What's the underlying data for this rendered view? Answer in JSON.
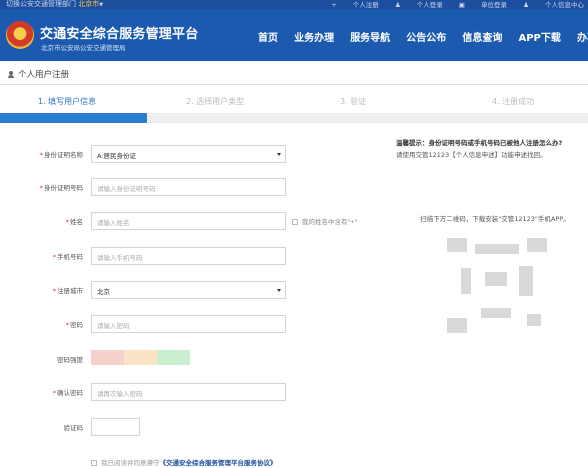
{
  "topbar": {
    "switch_prefix": "切换公安交通管理部门",
    "city": "北京市",
    "links": [
      "个人注册",
      "个人登录",
      "单位登录",
      "个人信息中心"
    ]
  },
  "header": {
    "title": "交通安全综合服务管理平台",
    "subtitle": "北京市公安局公安交通管理局",
    "nav": [
      "首页",
      "业务办理",
      "服务导航",
      "公告公布",
      "信息查询",
      "APP下载",
      "办事指南"
    ]
  },
  "breadcrumb": "个人用户注册",
  "steps": [
    {
      "label": "1. 填写用户信息",
      "active": true
    },
    {
      "label": "2. 选择用户类型",
      "active": false
    },
    {
      "label": "3. 验证",
      "active": false
    },
    {
      "label": "4. 注册成功",
      "active": false
    }
  ],
  "progress": 0.25,
  "form": {
    "id_type": {
      "label": "身份证明名称",
      "value": "A:居民身份证",
      "required": true
    },
    "id_number": {
      "label": "身份证明号码",
      "placeholder": "请输入身份证明号码",
      "required": true
    },
    "name": {
      "label": "姓名",
      "placeholder": "请输入姓名",
      "required": true
    },
    "name_check": "我的姓名中含有\"•\"",
    "phone": {
      "label": "手机号码",
      "placeholder": "请输入手机号码",
      "required": true
    },
    "city": {
      "label": "注册城市",
      "value": "北京",
      "required": true
    },
    "password": {
      "label": "密码",
      "placeholder": "请输入密码",
      "required": true
    },
    "strength": {
      "label": "密码强度",
      "colors": [
        "#f6d2cd",
        "#fbe3c5",
        "#cbeed0"
      ]
    },
    "confirm": {
      "label": "确认密码",
      "placeholder": "请再次输入密码",
      "required": true
    },
    "captcha": {
      "label": "验证码",
      "placeholder": ""
    },
    "agree_text": "我已阅读并同意遵守",
    "agree_link": "《交通安全综合服务管理平台服务协议》"
  },
  "tip": {
    "title": "温馨提示：身份证明号码或手机号码已被他人注册怎么办?",
    "line2": "请使用交管12123【个人信息申述】功能申述找回。",
    "qr_text": "扫描下方二维码，下载安装\"交管12123\"手机APP。"
  },
  "colors": {
    "brand": "#1c5ab0",
    "accent": "#2b7dd2"
  }
}
